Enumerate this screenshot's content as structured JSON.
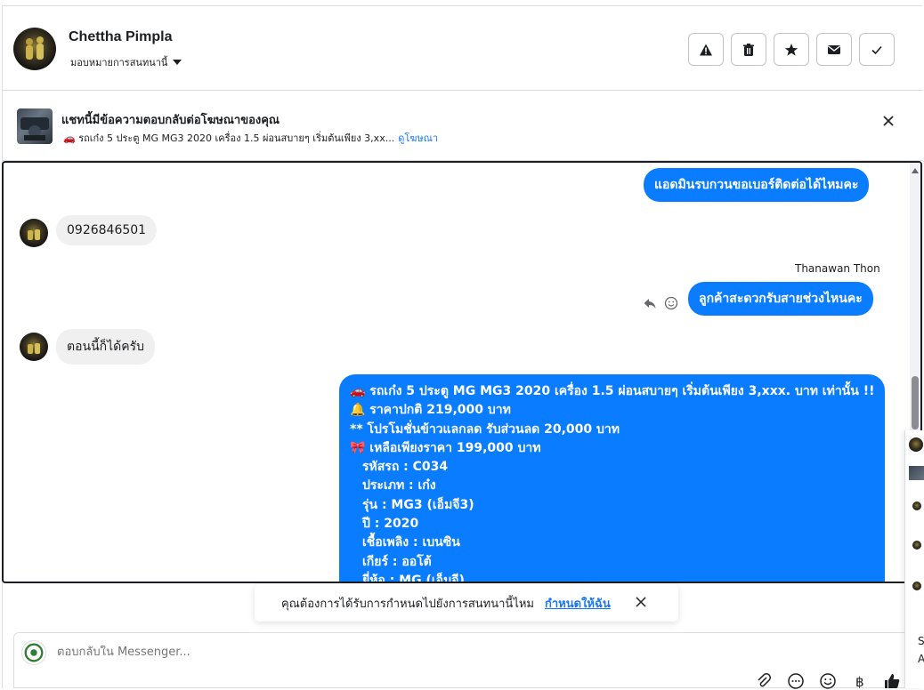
{
  "header": {
    "contact_name": "Chettha Pimpla",
    "assign_label": "มอบหมายการสนทนานี้",
    "actions": [
      "report-icon",
      "trash-icon",
      "star-icon",
      "envelope-icon",
      "check-icon"
    ]
  },
  "ad": {
    "title": "แชทนี้มีข้อความตอบกลับต่อโฆษณาของคุณ",
    "subtitle": "🚗 รถเก๋ง 5 ประตู MG MG3 2020 เครื่อง 1.5 ผ่อนสบายๆ เริ่มต้นเพียง 3,xx...",
    "link_label": "ดูโฆษณา"
  },
  "messages": {
    "m1": "แอดมินรบกวนขอเบอร์ติดต่อได้ไหมคะ",
    "m2": "0926846501",
    "sender": "Thanawan Thon",
    "m3": "ลูกค้าสะดวกรับสายช่วงไหนคะ",
    "m4": "ตอนนี้ก็ได้ครับ",
    "m5": [
      "🚗 รถเก๋ง 5 ประตู MG MG3 2020 เครื่อง 1.5 ผ่อนสบายๆ เริ่มต้นเพียง 3,xxx. บาท เท่านั้น !!",
      "🔔  ราคาปกติ 219,000 บาท",
      "** โปรโมชั่นข้าวแลกลด รับส่วนลด 20,000 บาท",
      "🎀  เหลือเพียงราคา 199,000 บาท",
      "รหัสรถ : C034",
      "ประเภท : เก๋ง",
      "รุ่น : MG3 (เอ็มจี3)",
      "ปี : 2020",
      "เชื้อเพลิง : เบนซิน",
      "เกียร์ : ออโต้",
      "ยี่ห้อ : MG (เอ็มจี)"
    ]
  },
  "reminder": {
    "text": "คุณต้องการได้รับการกำหนดไปยังการสนทนานี้ไหม",
    "link": "กำหนดให้ฉัน"
  },
  "composer": {
    "placeholder": "ตอบกลับใน Messenger...",
    "icons": [
      "attachment-icon",
      "more-icon",
      "emoji-icon",
      "baht-icon",
      "like-icon"
    ]
  },
  "side": {
    "items": [
      "S",
      "A"
    ]
  }
}
